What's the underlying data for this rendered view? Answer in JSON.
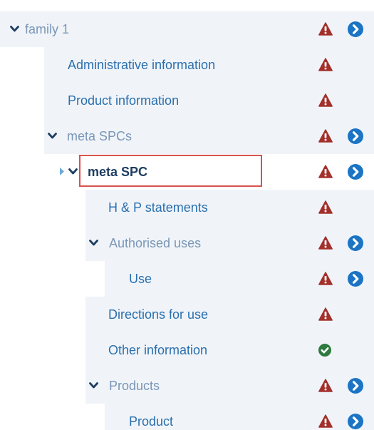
{
  "tree": {
    "family": {
      "label": "family 1",
      "expanded": true,
      "status": "warning",
      "navigable": true
    },
    "administrative": {
      "label": "Administrative information",
      "status": "warning"
    },
    "product_info": {
      "label": "Product information",
      "status": "warning"
    },
    "meta_spcs": {
      "label": "meta SPCs",
      "expanded": true,
      "status": "warning",
      "navigable": true
    },
    "meta_spc": {
      "label": "meta SPC",
      "expanded": true,
      "selected": true,
      "status": "warning",
      "navigable": true
    },
    "hp_statements": {
      "label": "H & P statements",
      "status": "warning"
    },
    "authorised_uses": {
      "label": "Authorised uses",
      "expanded": true,
      "status": "warning",
      "navigable": true
    },
    "use": {
      "label": "Use",
      "status": "warning",
      "navigable": true
    },
    "directions": {
      "label": "Directions for use",
      "status": "warning"
    },
    "other_info": {
      "label": "Other information",
      "status": "valid"
    },
    "products": {
      "label": "Products",
      "expanded": true,
      "status": "warning",
      "navigable": true
    },
    "product": {
      "label": "Product",
      "status": "warning",
      "navigable": true
    }
  },
  "icons": {
    "expand": "chevron-down-icon",
    "collapsed": "caret-right-icon",
    "warning": "warning-triangle-icon",
    "navigate": "chevron-circle-right-icon",
    "valid": "check-circle-icon"
  },
  "colors": {
    "warning": "#a3302b",
    "navigate": "#1b74c4",
    "valid": "#2e7a3f",
    "selection_border": "#d9534f",
    "row_background": "#f0f4f9",
    "link_text": "#2a6fad",
    "muted_text": "#7a96b6",
    "selected_text": "#1f3e62"
  }
}
